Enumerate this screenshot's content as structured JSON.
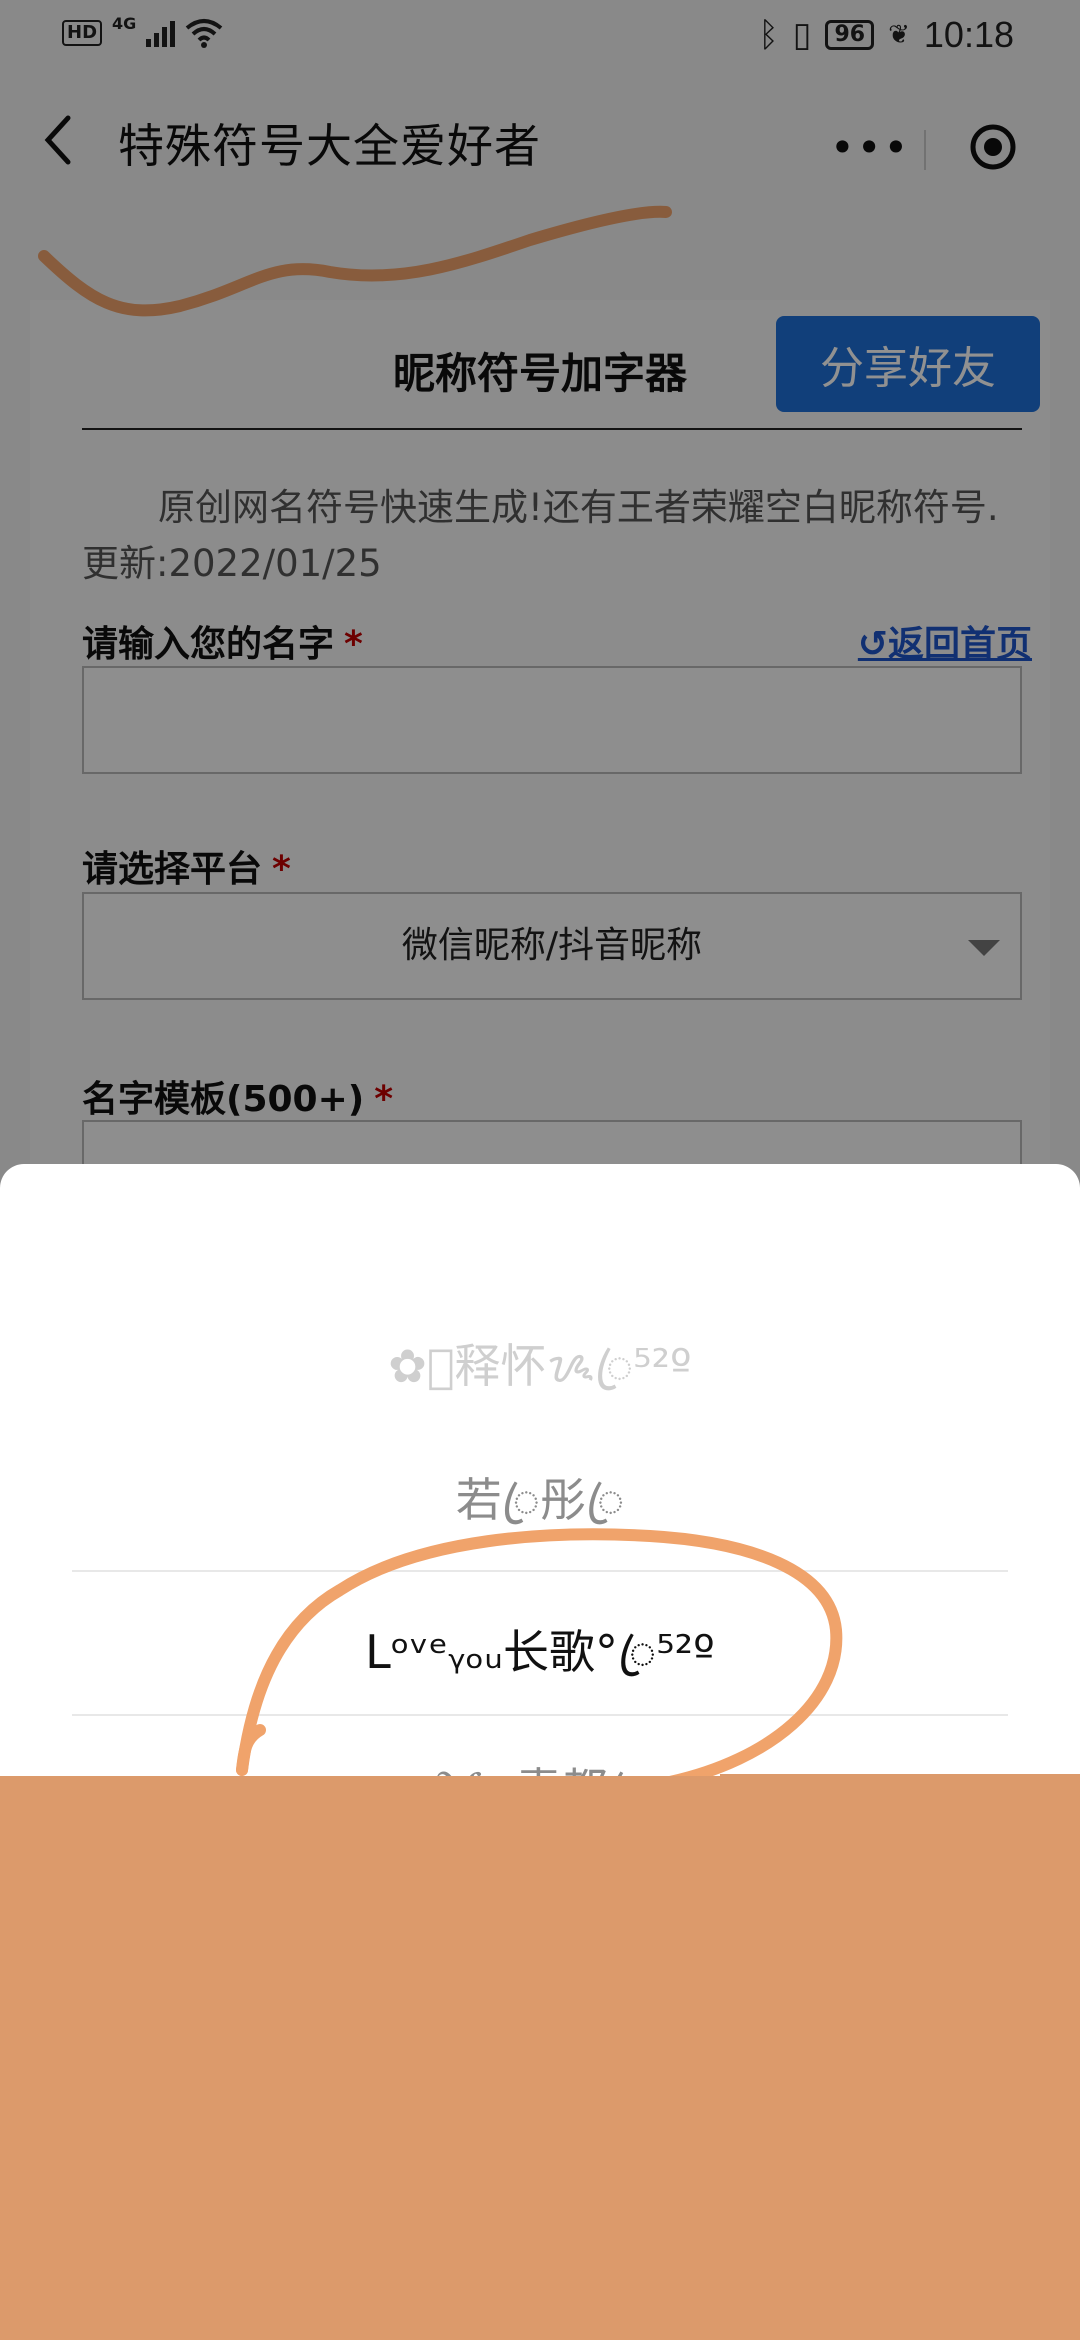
{
  "status_bar": {
    "hd": "HD",
    "network": "4G",
    "battery": "96",
    "time": "10:18",
    "icons": [
      "signal-icon",
      "wifi-icon",
      "bluetooth-icon",
      "vibrate-icon",
      "battery-icon",
      "leaf-icon"
    ]
  },
  "nav": {
    "title": "特殊符号大全爱好者",
    "more_label": "•••"
  },
  "content": {
    "heading": "昵称符号加字器",
    "share_button": "分享好友",
    "intro": "原创网名符号快速生成!还有王者荣耀空白昵称符号.更新:2022/01/25",
    "name_label": "请输入您的名字",
    "required_mark": "*",
    "home_link": "↺返回首页",
    "name_value": "",
    "platform_label": "请选择平台",
    "platform_value": "微信昵称/抖音昵称",
    "template_label": "名字模板(500+)"
  },
  "picker": {
    "options": [
      "✿ꦿ释怀ᝰ︎ꦿ⁵²º",
      "若ꦿ彤ꦿ",
      "Lᵒᵛᵉᵧₒᵤ长歌°ꦿ⁵²º",
      "ℳ℘青都ꦿ"
    ],
    "selected_index": 2
  },
  "colors": {
    "share_button": "#1f6fd6",
    "annotation_orange": "#f0a36b",
    "cover_block": "#dc9a6b",
    "required": "#c00000",
    "link": "#1f55c8"
  }
}
